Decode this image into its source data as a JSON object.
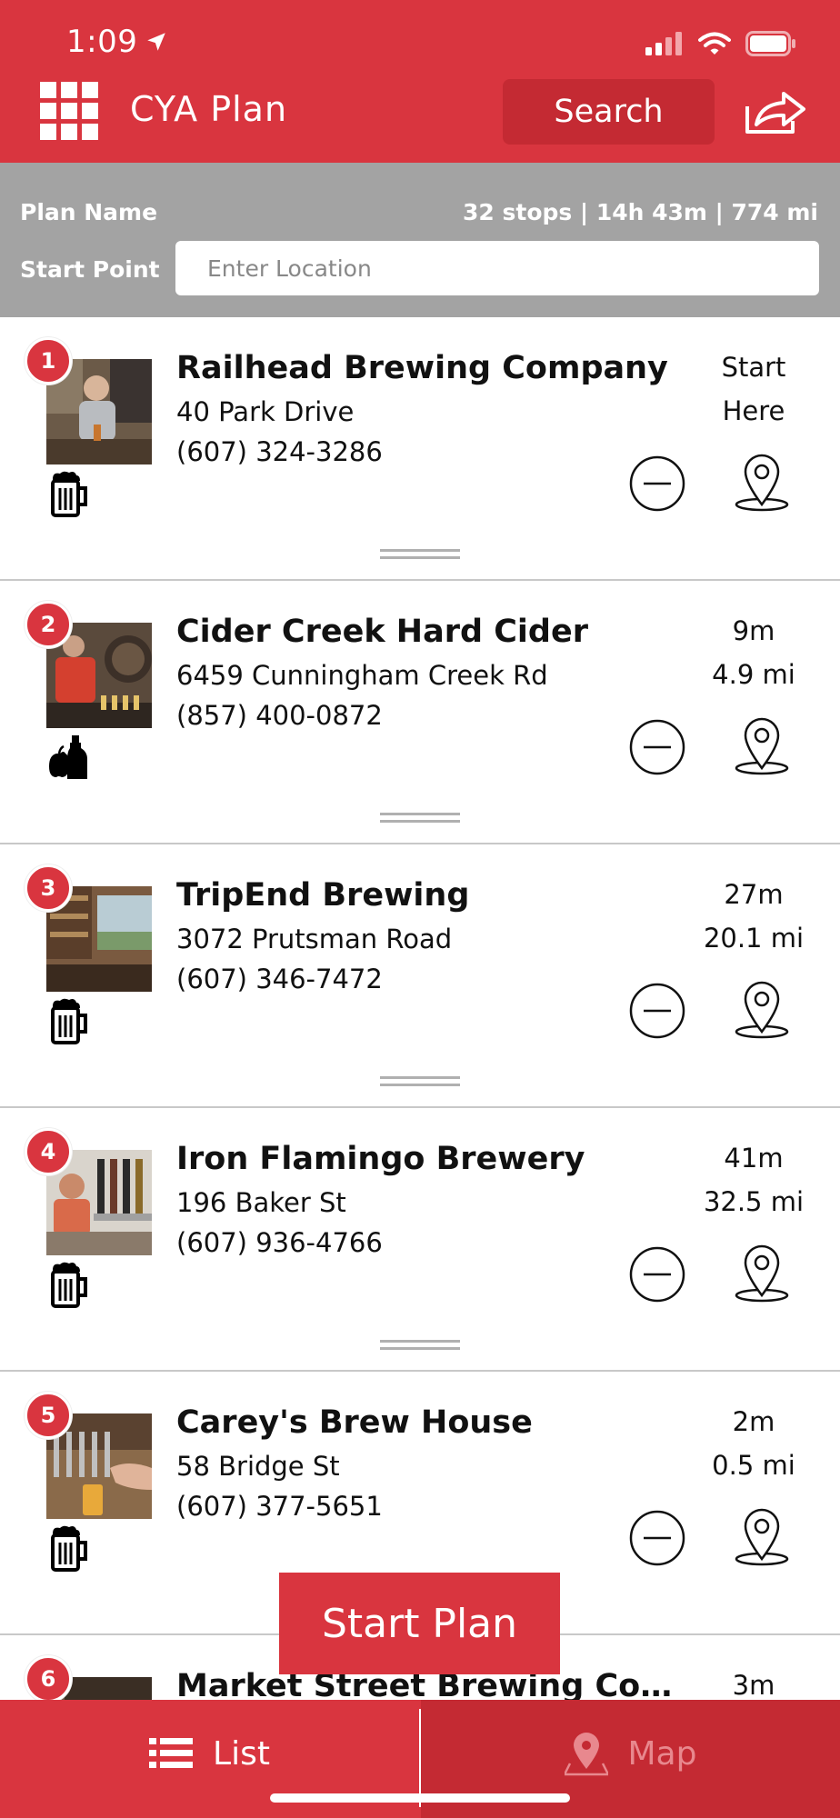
{
  "status_bar": {
    "time": "1:09"
  },
  "header": {
    "title": "CYA Plan",
    "search_label": "Search"
  },
  "plan": {
    "name_label": "Plan Name",
    "stats": "32 stops | 14h 43m | 774 mi",
    "start_label": "Start Point",
    "start_placeholder": "Enter Location"
  },
  "stops": [
    {
      "num": "1",
      "name": "Railhead Brewing Company",
      "address": "40 Park Drive",
      "phone": "(607) 324-3286",
      "line1": "Start",
      "line2": "Here",
      "category": "beer-mug-icon"
    },
    {
      "num": "2",
      "name": "Cider Creek Hard Cider",
      "address": "6459 Cunningham Creek Rd",
      "phone": "(857) 400-0872",
      "line1": "9m",
      "line2": "4.9 mi",
      "category": "cider-icon"
    },
    {
      "num": "3",
      "name": "TripEnd Brewing",
      "address": "3072 Prutsman Road",
      "phone": "(607) 346-7472",
      "line1": "27m",
      "line2": "20.1 mi",
      "category": "beer-mug-icon"
    },
    {
      "num": "4",
      "name": "Iron Flamingo Brewery",
      "address": "196 Baker St",
      "phone": "(607) 936-4766",
      "line1": "41m",
      "line2": "32.5 mi",
      "category": "beer-mug-icon"
    },
    {
      "num": "5",
      "name": "Carey's Brew House",
      "address": "58 Bridge St",
      "phone": "(607) 377-5651",
      "line1": "2m",
      "line2": "0.5 mi",
      "category": "beer-mug-icon"
    },
    {
      "num": "6",
      "name": "Market Street Brewing Compa...",
      "line1": "3m"
    }
  ],
  "start_plan_label": "Start Plan",
  "tabs": {
    "list": "List",
    "map": "Map"
  }
}
